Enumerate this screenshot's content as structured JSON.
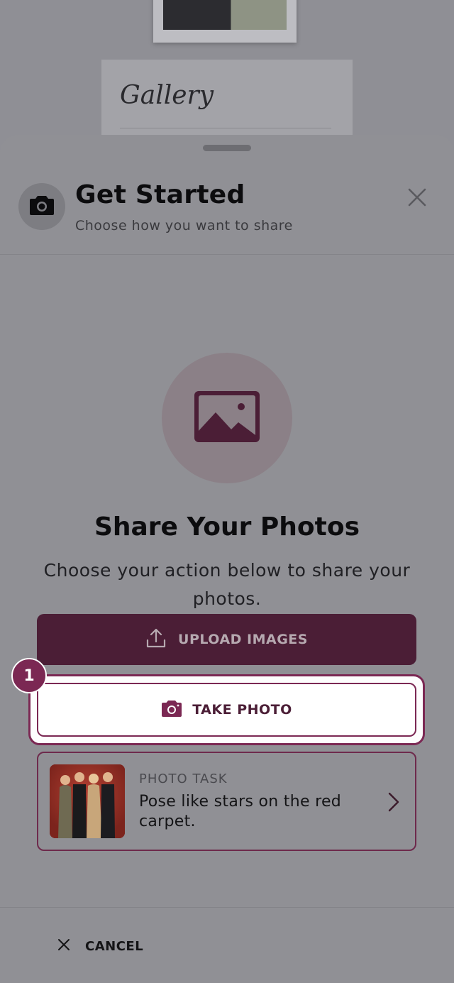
{
  "background": {
    "gallery_title": "Gallery"
  },
  "header": {
    "title": "Get Started",
    "subtitle": "Choose how you want to share",
    "icon": "camera-icon",
    "close_icon": "close-icon"
  },
  "hero": {
    "icon": "image-icon",
    "title": "Share Your Photos",
    "description": "Choose your action below to share your photos."
  },
  "actions": {
    "upload_label": "UPLOAD IMAGES",
    "upload_icon": "upload-icon",
    "take_photo_label": "TAKE PHOTO",
    "take_photo_icon": "camera-icon",
    "step_badge": "1"
  },
  "photo_task": {
    "kicker": "PHOTO TASK",
    "text": "Pose like stars on the red carpet.",
    "thumbnail": "red-carpet-group-photo",
    "chevron_icon": "chevron-right-icon"
  },
  "footer": {
    "cancel_label": "CANCEL",
    "cancel_icon": "close-icon"
  },
  "colors": {
    "brand": "#4b1e36",
    "accent": "#7b2853",
    "overlay_sheet": "#909095"
  }
}
